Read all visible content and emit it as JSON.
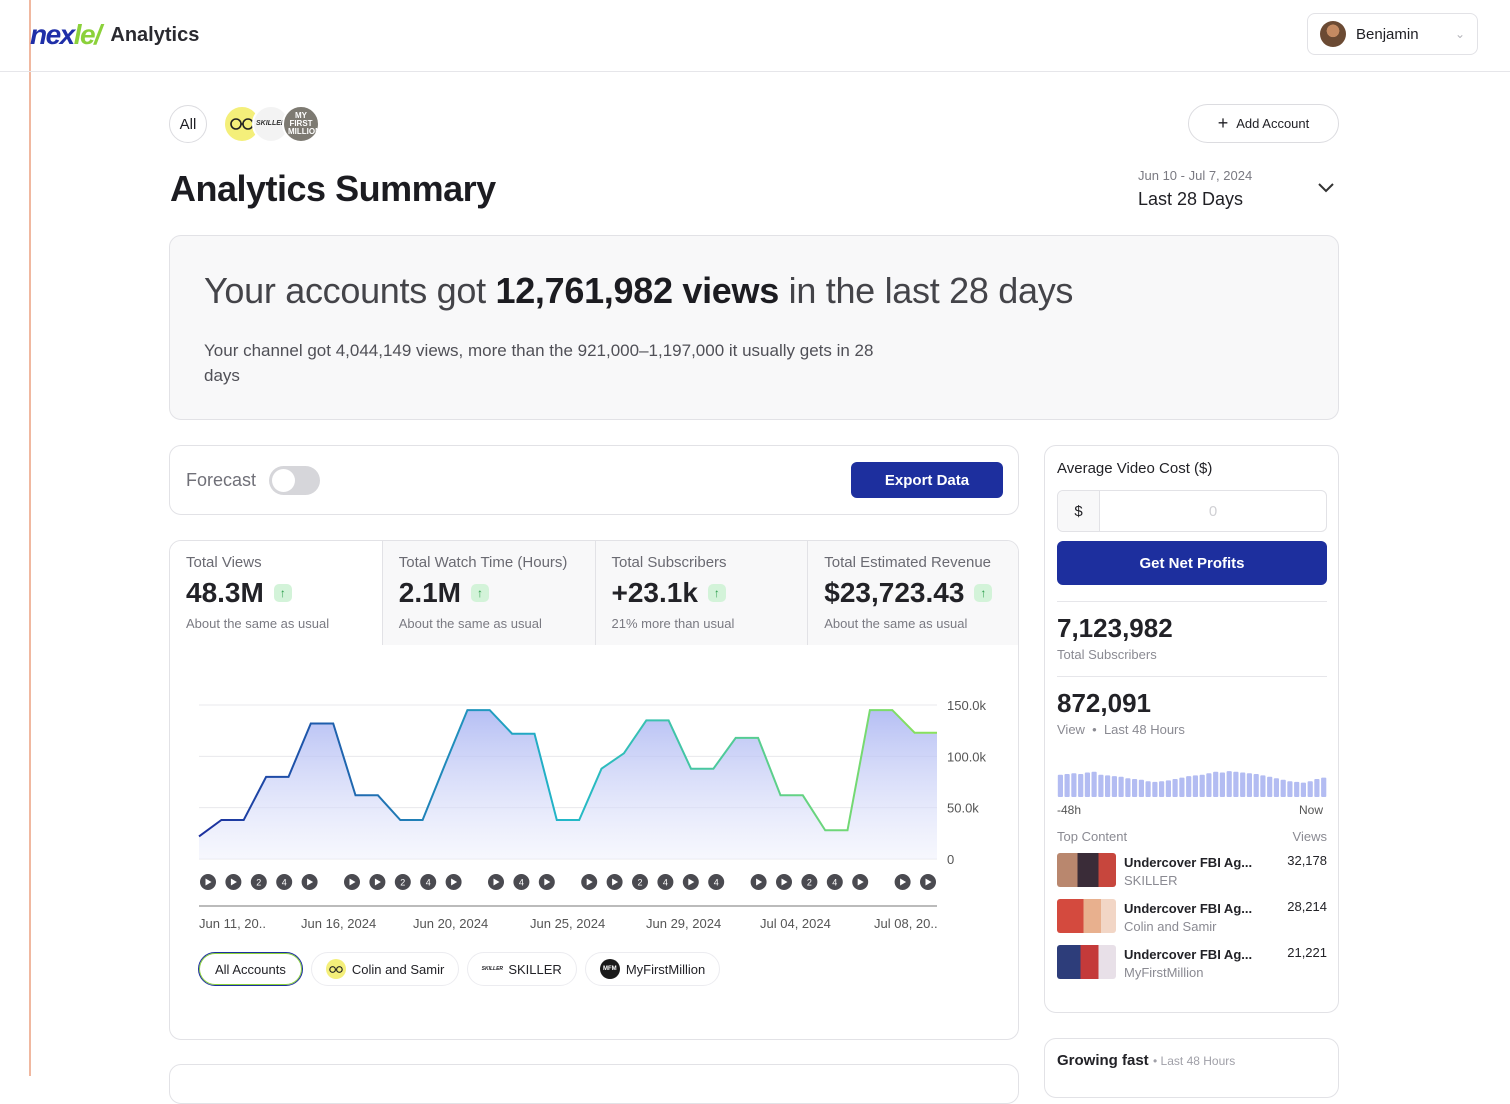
{
  "app": {
    "logo_text_1": "nex",
    "logo_text_2": "le",
    "name": "Analytics"
  },
  "user": {
    "name": "Benjamin"
  },
  "accounts_bar": {
    "all_label": "All",
    "avatars": [
      {
        "name": "Colin and Samir",
        "text": "",
        "color": "#f4ef7a"
      },
      {
        "name": "SKILLER",
        "text": "SKILLER",
        "color": "#f3f3f3"
      },
      {
        "name": "MyFirstMillion",
        "text": "MY FIRST MILLION",
        "color": "#7d7a72"
      }
    ],
    "add_account_label": "Add Account"
  },
  "header": {
    "title": "Analytics Summary",
    "range_dates": "Jun 10 - Jul 7, 2024",
    "range_label": "Last 28 Days"
  },
  "summary": {
    "prefix": "Your accounts got ",
    "views_bold": "12,761,982 views",
    "suffix": " in the last 28 days",
    "detail": "Your channel got 4,044,149 views, more than the 921,000–1,197,000 it usually gets in 28 days"
  },
  "toolbar": {
    "forecast_label": "Forecast",
    "forecast_on": false,
    "export_label": "Export Data"
  },
  "metrics": [
    {
      "label": "Total Views",
      "value": "48.3M",
      "note": "About the same as usual"
    },
    {
      "label": "Total Watch Time (Hours)",
      "value": "2.1M",
      "note": "About the same as usual"
    },
    {
      "label": "Total Subscribers",
      "value": "+23.1k",
      "note": "21% more than usual"
    },
    {
      "label": "Total Estimated Revenue",
      "value": "$23,723.43",
      "note": "About the same as usual"
    }
  ],
  "chart_data": {
    "type": "area",
    "x": [
      "Jun 10",
      "Jun 11",
      "Jun 12",
      "Jun 13",
      "Jun 14",
      "Jun 15",
      "Jun 16",
      "Jun 17",
      "Jun 18",
      "Jun 19",
      "Jun 20",
      "Jun 21",
      "Jun 22",
      "Jun 23",
      "Jun 24",
      "Jun 25",
      "Jun 26",
      "Jun 27",
      "Jun 28",
      "Jun 29",
      "Jun 30",
      "Jul 01",
      "Jul 02",
      "Jul 03",
      "Jul 04",
      "Jul 05",
      "Jul 06",
      "Jul 07",
      "Jul 08",
      "Jul 09"
    ],
    "y": [
      22000,
      38000,
      38000,
      80000,
      80000,
      132000,
      132000,
      62000,
      62000,
      38000,
      38000,
      92000,
      145000,
      145000,
      122000,
      122000,
      38000,
      38000,
      88000,
      103000,
      135000,
      135000,
      88000,
      88000,
      118000,
      118000,
      62000,
      62000,
      28000,
      28000,
      145000,
      145000,
      123000,
      123000
    ],
    "y_ticks": [
      "150.0k",
      "100.0k",
      "50.0k",
      "0"
    ],
    "ylim": [
      0,
      150000
    ],
    "x_tick_labels": [
      "Jun 11, 20..",
      "Jun 16, 2024",
      "Jun 20, 2024",
      "Jun 25, 2024",
      "Jun 29, 2024",
      "Jul 04, 2024",
      "Jul 08, 20.."
    ],
    "grid": true,
    "markers": [
      [
        "play",
        "play",
        "2",
        "4",
        "play"
      ],
      [
        "play",
        "play",
        "2",
        "4",
        "play"
      ],
      [
        "play",
        "4",
        "play"
      ],
      [
        "play",
        "play",
        "2",
        "4",
        "play",
        "4"
      ],
      [
        "play",
        "play",
        "2",
        "4",
        "play"
      ],
      [
        "play",
        "play"
      ]
    ]
  },
  "legend": [
    {
      "label": "All Accounts",
      "active": true
    },
    {
      "label": "Colin and Samir",
      "active": false,
      "color": "#f4ef7a",
      "text": ""
    },
    {
      "label": "SKILLER",
      "active": false,
      "color": "#ffffff",
      "text": "SKILLER"
    },
    {
      "label": "MyFirstMillion",
      "active": false,
      "color": "#1a1a1a",
      "text": "MFM"
    }
  ],
  "side": {
    "cost_title": "Average Video Cost ($)",
    "currency": "$",
    "cost_placeholder": "0",
    "net_profit_label": "Get Net Profits",
    "total_subs": "7,123,982",
    "total_subs_label": "Total Subscribers",
    "views_48": "872,091",
    "views_48_label": "View",
    "views_48_range": "Last 48 Hours",
    "spark": [
      0.62,
      0.64,
      0.66,
      0.64,
      0.68,
      0.7,
      0.62,
      0.6,
      0.58,
      0.56,
      0.52,
      0.5,
      0.48,
      0.44,
      0.42,
      0.44,
      0.46,
      0.5,
      0.54,
      0.58,
      0.6,
      0.62,
      0.66,
      0.7,
      0.68,
      0.72,
      0.7,
      0.68,
      0.66,
      0.64,
      0.6,
      0.56,
      0.52,
      0.48,
      0.44,
      0.42,
      0.4,
      0.44,
      0.5,
      0.54
    ],
    "axis_start": "-48h",
    "axis_end": "Now",
    "top_content_label": "Top Content",
    "views_col_label": "Views",
    "top_content": [
      {
        "title": "Undercover FBI Ag...",
        "channel": "SKILLER",
        "views": "32,178"
      },
      {
        "title": "Undercover FBI Ag...",
        "channel": "Colin and Samir",
        "views": "28,214"
      },
      {
        "title": "Undercover FBI Ag...",
        "channel": "MyFirstMillion",
        "views": "21,221"
      }
    ]
  },
  "growing": {
    "title": "Growing fast",
    "sub": "Last 48 Hours"
  }
}
